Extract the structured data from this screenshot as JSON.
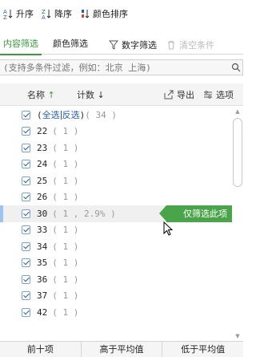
{
  "sort": {
    "asc_label": "升序",
    "desc_label": "降序",
    "color_label": "颜色排序"
  },
  "tabs": {
    "content_filter": "内容筛选",
    "color_filter": "颜色筛选",
    "number_filter": "数字筛选",
    "clear_label": "清空条件"
  },
  "search": {
    "placeholder": "(支持多条件过滤，例如：北京 上海)"
  },
  "header": {
    "name_label": "名称",
    "name_arrow": "↑",
    "count_label": "计数",
    "count_arrow": "↓",
    "export_label": "导出",
    "options_label": "选项"
  },
  "list": {
    "select_all": "全选",
    "invert": "反选",
    "all_open": "(",
    "all_close": ")",
    "all_count": "( 34 )",
    "items": [
      {
        "name": "22",
        "count": "( 1 )"
      },
      {
        "name": "23",
        "count": "( 1 )"
      },
      {
        "name": "24",
        "count": "( 1 )"
      },
      {
        "name": "25",
        "count": "( 1 )"
      },
      {
        "name": "26",
        "count": "( 1 )"
      },
      {
        "name": "30",
        "count": "( 1 , 2.9% )"
      },
      {
        "name": "33",
        "count": "( 1 )"
      },
      {
        "name": "34",
        "count": "( 1 )"
      },
      {
        "name": "35",
        "count": "( 1 )"
      },
      {
        "name": "36",
        "count": "( 1 )"
      },
      {
        "name": "37",
        "count": "( 1 )"
      },
      {
        "name": "42",
        "count": "( 1 )"
      }
    ],
    "only_filter_label": "仅筛选此项"
  },
  "footer": {
    "top10": "前十项",
    "above_avg": "高于平均值",
    "below_avg": "低于平均值"
  },
  "colors": {
    "accent_green": "#4aa44a",
    "link_blue": "#2a5db0"
  }
}
